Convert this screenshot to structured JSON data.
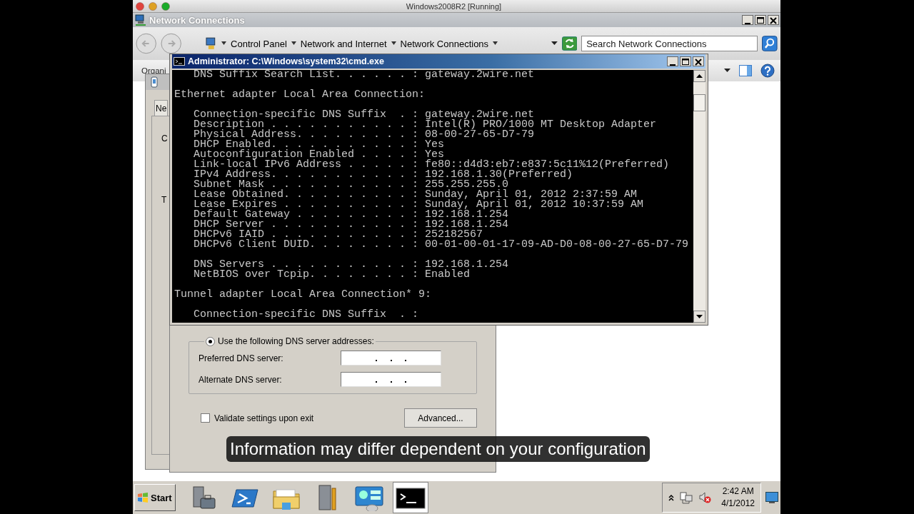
{
  "vm_window": {
    "title": "Windows2008R2 [Running]"
  },
  "explorer": {
    "title": "Network Connections",
    "breadcrumbs": [
      "Control Panel",
      "Network and Internet",
      "Network Connections"
    ],
    "search": {
      "placeholder": "Search Network Connections"
    },
    "command_bar": {
      "label": "Organi"
    }
  },
  "properties_dialog": {
    "tab": "Ne",
    "labels": [
      "C",
      "T"
    ]
  },
  "dns_dialog": {
    "dns_option": {
      "label": "Use the following DNS server addresses:",
      "selected": true
    },
    "fields": [
      {
        "label": "Preferred DNS server:"
      },
      {
        "label": "Alternate DNS server:"
      }
    ],
    "validate": {
      "label": "Validate settings upon exit",
      "checked": false
    },
    "advanced_button": "Advanced..."
  },
  "console": {
    "title": "Administrator: C:\\Windows\\system32\\cmd.exe",
    "sections": [
      [
        "   DNS Suffix Search List. . . . . . : gateway.2wire.net"
      ],
      [
        "Ethernet adapter Local Area Connection:"
      ],
      [
        "   Connection-specific DNS Suffix  . : gateway.2wire.net",
        "   Description . . . . . . . . . . . : Intel(R) PRO/1000 MT Desktop Adapter",
        "   Physical Address. . . . . . . . . : 08-00-27-65-D7-79",
        "   DHCP Enabled. . . . . . . . . . . : Yes",
        "   Autoconfiguration Enabled . . . . : Yes",
        "   Link-local IPv6 Address . . . . . : fe80::d4d3:eb7:e837:5c11%12(Preferred)",
        "   IPv4 Address. . . . . . . . . . . : 192.168.1.30(Preferred)",
        "   Subnet Mask . . . . . . . . . . . : 255.255.255.0",
        "   Lease Obtained. . . . . . . . . . : Sunday, April 01, 2012 2:37:59 AM",
        "   Lease Expires . . . . . . . . . . : Sunday, April 01, 2012 10:37:59 AM",
        "   Default Gateway . . . . . . . . . : 192.168.1.254",
        "   DHCP Server . . . . . . . . . . . : 192.168.1.254",
        "   DHCPv6 IAID . . . . . . . . . . . : 252182567",
        "   DHCPv6 Client DUID. . . . . . . . : 00-01-00-01-17-09-AD-D0-08-00-27-65-D7-79"
      ],
      [
        "   DNS Servers . . . . . . . . . . . : 192.168.1.254",
        "   NetBIOS over Tcpip. . . . . . . . : Enabled"
      ],
      [
        "Tunnel adapter Local Area Connection* 9:"
      ],
      [
        "   Connection-specific DNS Suffix  . :"
      ]
    ]
  },
  "caption": "Information may differ dependent on your configuration",
  "taskbar": {
    "start": "Start",
    "items": [
      {
        "kind": "server",
        "active": false
      },
      {
        "kind": "shell",
        "active": false
      },
      {
        "kind": "folder",
        "active": false
      },
      {
        "kind": "tools",
        "active": false
      },
      {
        "kind": "panel",
        "active": false
      },
      {
        "kind": "console",
        "active": true
      }
    ],
    "clock": {
      "time": "2:42 AM",
      "date": "4/1/2012"
    }
  }
}
